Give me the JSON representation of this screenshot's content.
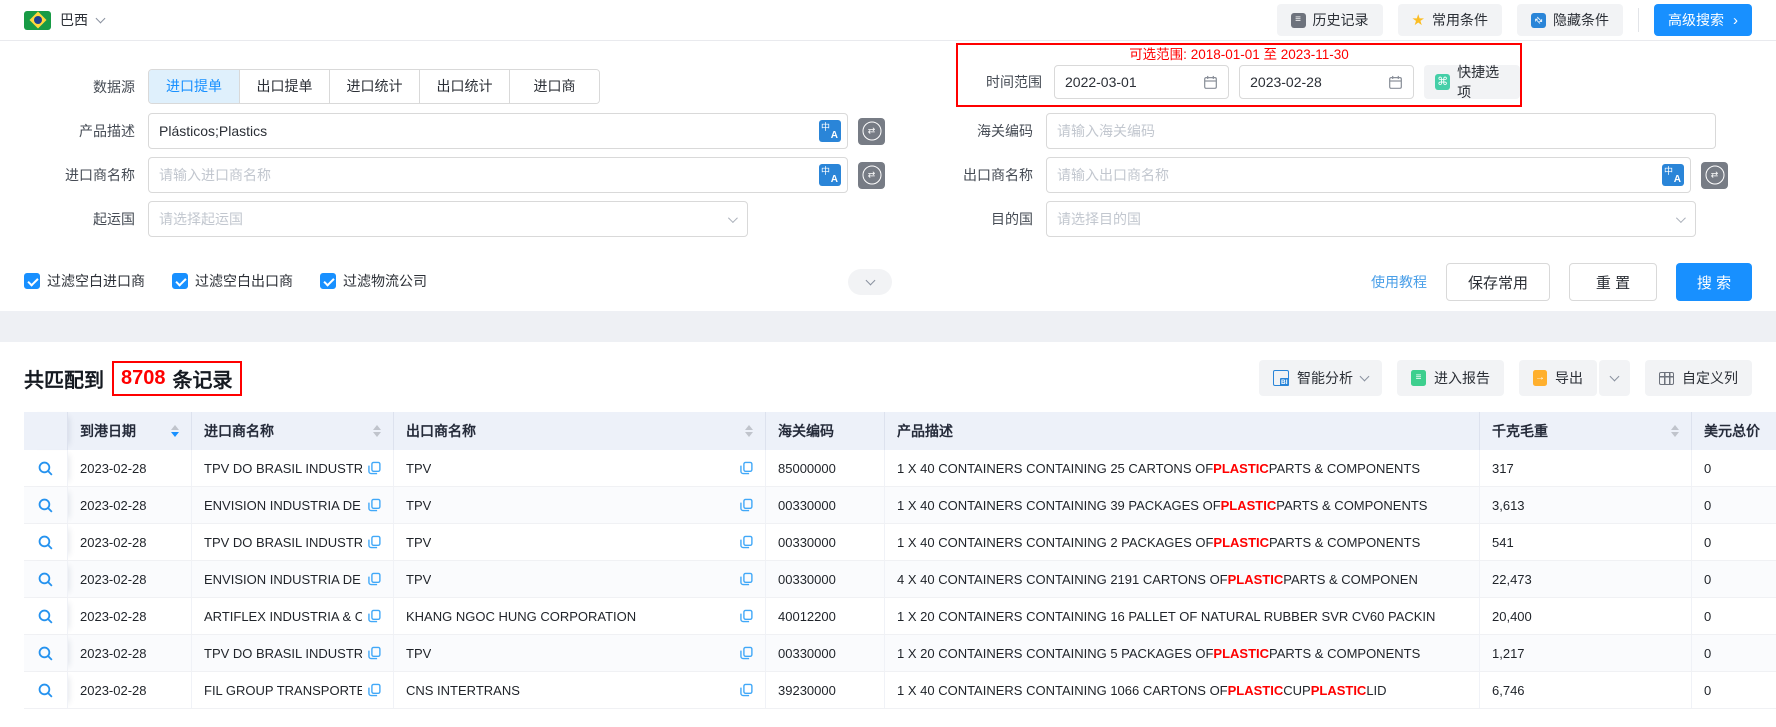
{
  "topbar": {
    "country": "巴西",
    "history_btn": "历史记录",
    "favorites_btn": "常用条件",
    "hide_btn": "隐藏条件",
    "advanced_btn": "高级搜索"
  },
  "search": {
    "datasource_label": "数据源",
    "datasource_tabs": [
      "进口提单",
      "出口提单",
      "进口统计",
      "出口统计",
      "进口商"
    ],
    "active_tab": "进口提单",
    "time": {
      "hint": "可选范围: 2018-01-01 至 2023-11-30",
      "label": "时间范围",
      "start": "2022-03-01",
      "end": "2023-02-28",
      "quick_btn": "快捷选项"
    },
    "fields": {
      "product_desc": {
        "label": "产品描述",
        "value": "Plásticos;Plastics"
      },
      "hs_code": {
        "label": "海关编码",
        "placeholder": "请输入海关编码"
      },
      "importer": {
        "label": "进口商名称",
        "placeholder": "请输入进口商名称"
      },
      "exporter": {
        "label": "出口商名称",
        "placeholder": "请输入出口商名称"
      },
      "origin": {
        "label": "起运国",
        "placeholder": "请选择起运国"
      },
      "dest": {
        "label": "目的国",
        "placeholder": "请选择目的国"
      }
    },
    "checkboxes": [
      {
        "label": "过滤空白进口商",
        "checked": true
      },
      {
        "label": "过滤空白出口商",
        "checked": true
      },
      {
        "label": "过滤物流公司",
        "checked": true
      }
    ],
    "tutorial_link": "使用教程",
    "save_btn": "保存常用",
    "reset_btn": "重 置",
    "search_btn": "搜 索"
  },
  "results": {
    "match_prefix": "共匹配到",
    "match_count": "8708",
    "match_suffix": "条记录",
    "analysis_btn": "智能分析",
    "report_btn": "进入报告",
    "export_btn": "导出",
    "custom_cols_btn": "自定义列",
    "highlight_term": "PLASTIC",
    "table": {
      "headers": [
        {
          "label": "到港日期",
          "sortable": true,
          "sort": "desc"
        },
        {
          "label": "进口商名称",
          "sortable": true,
          "sort": null
        },
        {
          "label": "出口商名称",
          "sortable": true,
          "sort": null
        },
        {
          "label": "海关编码",
          "sortable": false,
          "sort": null
        },
        {
          "label": "产品描述",
          "sortable": false,
          "sort": null
        },
        {
          "label": "千克毛重",
          "sortable": true,
          "sort": null
        },
        {
          "label": "美元总价",
          "sortable": false,
          "sort": null
        }
      ],
      "rows": [
        {
          "date": "2023-02-28",
          "importer": "TPV DO BRASIL INDUSTR",
          "exporter": "TPV",
          "hs": "85000000",
          "desc": "1 X 40 CONTAINERS CONTAINING 25 CARTONS OF PLASTIC PARTS & COMPONENTS",
          "weight": "317",
          "price": "0"
        },
        {
          "date": "2023-02-28",
          "importer": "ENVISION INDUSTRIA DE",
          "exporter": "TPV",
          "hs": "00330000",
          "desc": "1 X 40 CONTAINERS CONTAINING 39 PACKAGES OF PLASTIC PARTS & COMPONENTS",
          "weight": "3,613",
          "price": "0"
        },
        {
          "date": "2023-02-28",
          "importer": "TPV DO BRASIL INDUSTR",
          "exporter": "TPV",
          "hs": "00330000",
          "desc": "1 X 40 CONTAINERS CONTAINING 2 PACKAGES OF PLASTIC PARTS & COMPONENTS",
          "weight": "541",
          "price": "0"
        },
        {
          "date": "2023-02-28",
          "importer": "ENVISION INDUSTRIA DE",
          "exporter": "TPV",
          "hs": "00330000",
          "desc": "4 X 40 CONTAINERS CONTAINING 2191 CARTONS OF PLASTIC PARTS & COMPONEN",
          "weight": "22,473",
          "price": "0"
        },
        {
          "date": "2023-02-28",
          "importer": "ARTIFLEX INDUSTRIA & C",
          "exporter": "KHANG NGOC HUNG CORPORATION",
          "hs": "40012200",
          "desc": "1 X 20 CONTAINERS CONTAINING 16 PALLET OF NATURAL RUBBER SVR CV60 PACKIN",
          "weight": "20,400",
          "price": "0"
        },
        {
          "date": "2023-02-28",
          "importer": "TPV DO BRASIL INDUSTR",
          "exporter": "TPV",
          "hs": "00330000",
          "desc": "1 X 20 CONTAINERS CONTAINING 5 PACKAGES OF PLASTIC PARTS & COMPONENTS",
          "weight": "1,217",
          "price": "0"
        },
        {
          "date": "2023-02-28",
          "importer": "FIL GROUP TRANSPORTE",
          "exporter": "CNS INTERTRANS",
          "hs": "39230000",
          "desc": "1 X 40 CONTAINERS CONTAINING 1066 CARTONS OF PLASTIC CUP PLASTIC LID",
          "weight": "6,746",
          "price": "0"
        }
      ]
    }
  }
}
